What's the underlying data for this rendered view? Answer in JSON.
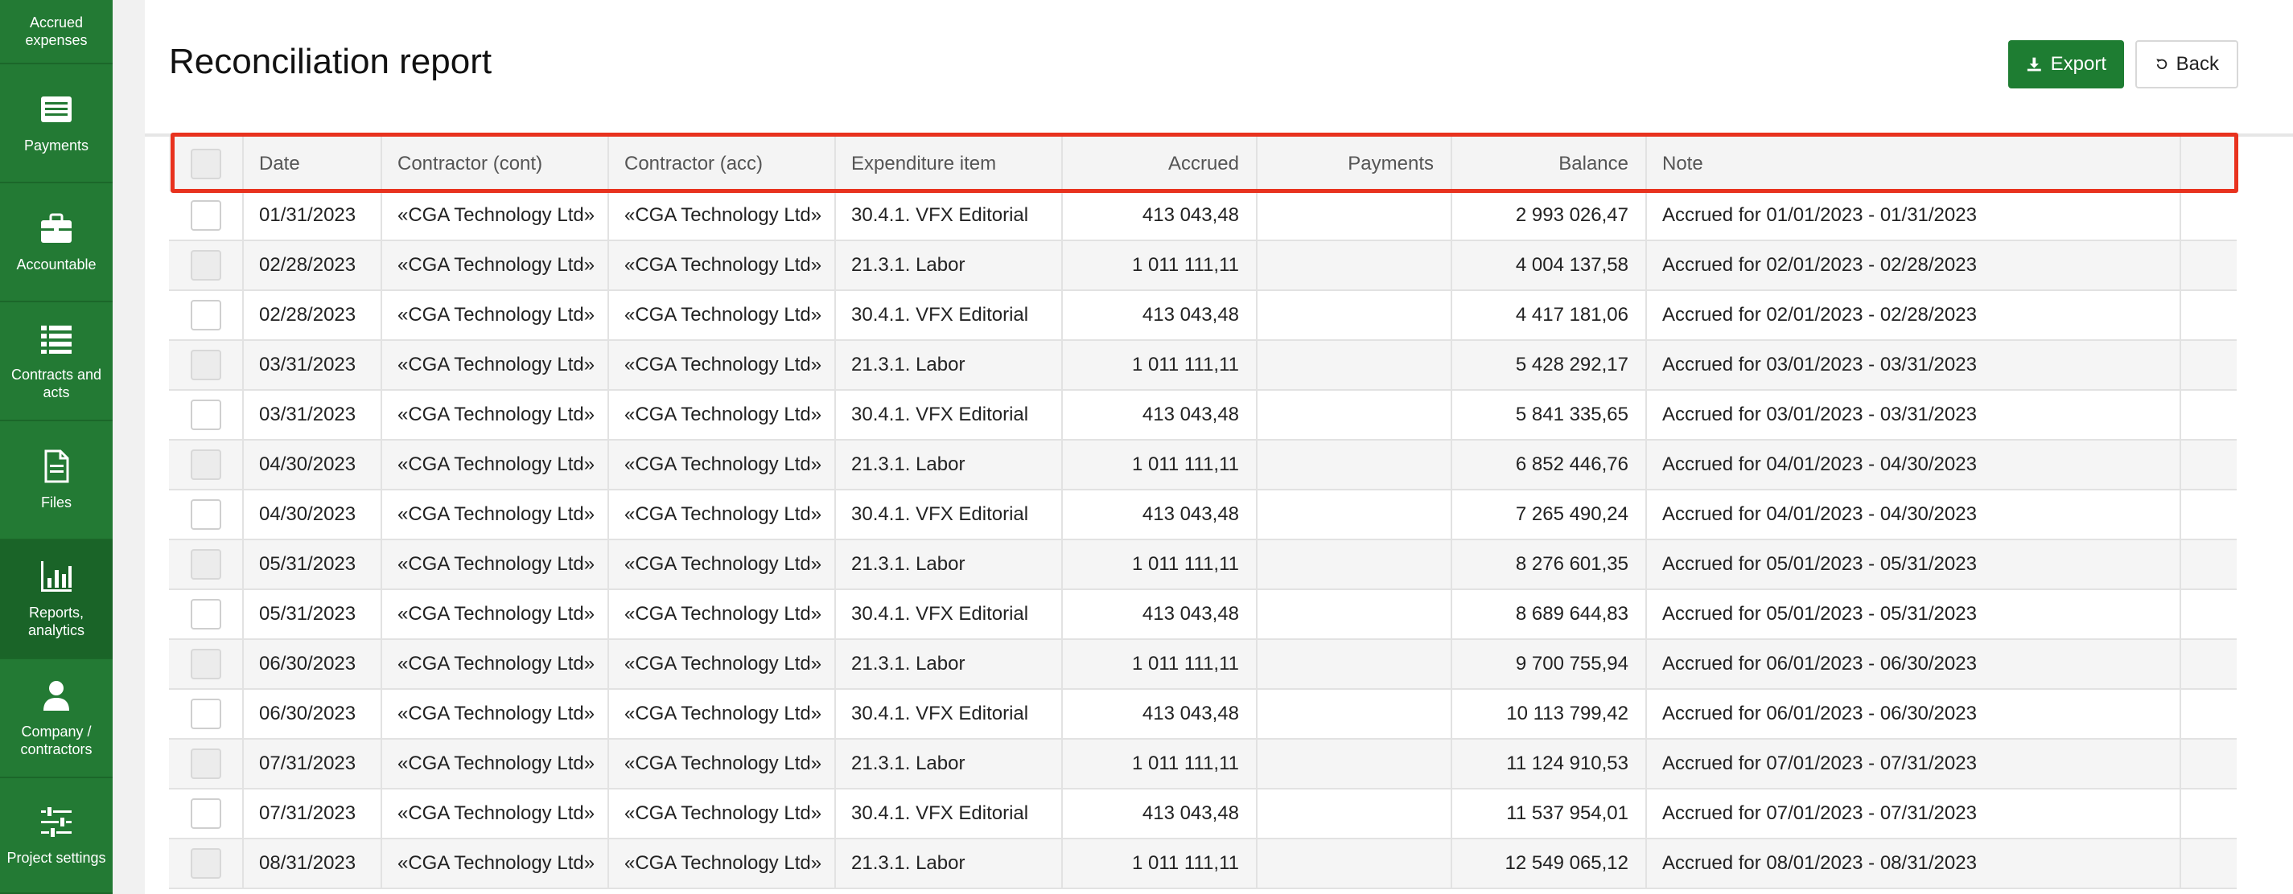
{
  "sidebar": {
    "items": [
      {
        "label": "Accrued expenses",
        "icon": "accrued-expenses-icon"
      },
      {
        "label": "Payments",
        "icon": "payments-icon"
      },
      {
        "label": "Accountable",
        "icon": "briefcase-icon"
      },
      {
        "label": "Contracts and acts",
        "icon": "list-icon"
      },
      {
        "label": "Files",
        "icon": "file-icon"
      },
      {
        "label": "Reports, analytics",
        "icon": "bar-chart-icon"
      },
      {
        "label": "Company / contractors",
        "icon": "user-icon"
      },
      {
        "label": "Project settings",
        "icon": "sliders-icon"
      }
    ],
    "active_index": 5
  },
  "page": {
    "title": "Reconciliation report",
    "export_label": "Export",
    "back_label": "Back"
  },
  "colors": {
    "sidebar": "#237a34",
    "accent": "#1e7d32",
    "highlight": "#e8321e"
  },
  "table": {
    "columns": [
      "Date",
      "Contractor (cont)",
      "Contractor (acc)",
      "Expenditure item",
      "Accrued",
      "Payments",
      "Balance",
      "Note"
    ],
    "rows": [
      {
        "date": "01/31/2023",
        "cont": "«CGA Technology Ltd»",
        "acc": "«CGA Technology Ltd»",
        "item": "30.4.1. VFX Editorial",
        "accrued": "413 043,48",
        "payments": "",
        "balance": "2 993 026,47",
        "note": "Accrued for 01/01/2023 - 01/31/2023"
      },
      {
        "date": "02/28/2023",
        "cont": "«CGA Technology Ltd»",
        "acc": "«CGA Technology Ltd»",
        "item": "21.3.1. Labor",
        "accrued": "1 011 111,11",
        "payments": "",
        "balance": "4 004 137,58",
        "note": "Accrued for 02/01/2023 - 02/28/2023"
      },
      {
        "date": "02/28/2023",
        "cont": "«CGA Technology Ltd»",
        "acc": "«CGA Technology Ltd»",
        "item": "30.4.1. VFX Editorial",
        "accrued": "413 043,48",
        "payments": "",
        "balance": "4 417 181,06",
        "note": "Accrued for 02/01/2023 - 02/28/2023"
      },
      {
        "date": "03/31/2023",
        "cont": "«CGA Technology Ltd»",
        "acc": "«CGA Technology Ltd»",
        "item": "21.3.1. Labor",
        "accrued": "1 011 111,11",
        "payments": "",
        "balance": "5 428 292,17",
        "note": "Accrued for 03/01/2023 - 03/31/2023"
      },
      {
        "date": "03/31/2023",
        "cont": "«CGA Technology Ltd»",
        "acc": "«CGA Technology Ltd»",
        "item": "30.4.1. VFX Editorial",
        "accrued": "413 043,48",
        "payments": "",
        "balance": "5 841 335,65",
        "note": "Accrued for 03/01/2023 - 03/31/2023"
      },
      {
        "date": "04/30/2023",
        "cont": "«CGA Technology Ltd»",
        "acc": "«CGA Technology Ltd»",
        "item": "21.3.1. Labor",
        "accrued": "1 011 111,11",
        "payments": "",
        "balance": "6 852 446,76",
        "note": "Accrued for 04/01/2023 - 04/30/2023"
      },
      {
        "date": "04/30/2023",
        "cont": "«CGA Technology Ltd»",
        "acc": "«CGA Technology Ltd»",
        "item": "30.4.1. VFX Editorial",
        "accrued": "413 043,48",
        "payments": "",
        "balance": "7 265 490,24",
        "note": "Accrued for 04/01/2023 - 04/30/2023"
      },
      {
        "date": "05/31/2023",
        "cont": "«CGA Technology Ltd»",
        "acc": "«CGA Technology Ltd»",
        "item": "21.3.1. Labor",
        "accrued": "1 011 111,11",
        "payments": "",
        "balance": "8 276 601,35",
        "note": "Accrued for 05/01/2023 - 05/31/2023"
      },
      {
        "date": "05/31/2023",
        "cont": "«CGA Technology Ltd»",
        "acc": "«CGA Technology Ltd»",
        "item": "30.4.1. VFX Editorial",
        "accrued": "413 043,48",
        "payments": "",
        "balance": "8 689 644,83",
        "note": "Accrued for 05/01/2023 - 05/31/2023"
      },
      {
        "date": "06/30/2023",
        "cont": "«CGA Technology Ltd»",
        "acc": "«CGA Technology Ltd»",
        "item": "21.3.1. Labor",
        "accrued": "1 011 111,11",
        "payments": "",
        "balance": "9 700 755,94",
        "note": "Accrued for 06/01/2023 - 06/30/2023"
      },
      {
        "date": "06/30/2023",
        "cont": "«CGA Technology Ltd»",
        "acc": "«CGA Technology Ltd»",
        "item": "30.4.1. VFX Editorial",
        "accrued": "413 043,48",
        "payments": "",
        "balance": "10 113 799,42",
        "note": "Accrued for 06/01/2023 - 06/30/2023"
      },
      {
        "date": "07/31/2023",
        "cont": "«CGA Technology Ltd»",
        "acc": "«CGA Technology Ltd»",
        "item": "21.3.1. Labor",
        "accrued": "1 011 111,11",
        "payments": "",
        "balance": "11 124 910,53",
        "note": "Accrued for 07/01/2023 - 07/31/2023"
      },
      {
        "date": "07/31/2023",
        "cont": "«CGA Technology Ltd»",
        "acc": "«CGA Technology Ltd»",
        "item": "30.4.1. VFX Editorial",
        "accrued": "413 043,48",
        "payments": "",
        "balance": "11 537 954,01",
        "note": "Accrued for 07/01/2023 - 07/31/2023"
      },
      {
        "date": "08/31/2023",
        "cont": "«CGA Technology Ltd»",
        "acc": "«CGA Technology Ltd»",
        "item": "21.3.1. Labor",
        "accrued": "1 011 111,11",
        "payments": "",
        "balance": "12 549 065,12",
        "note": "Accrued for 08/01/2023 - 08/31/2023"
      }
    ]
  }
}
